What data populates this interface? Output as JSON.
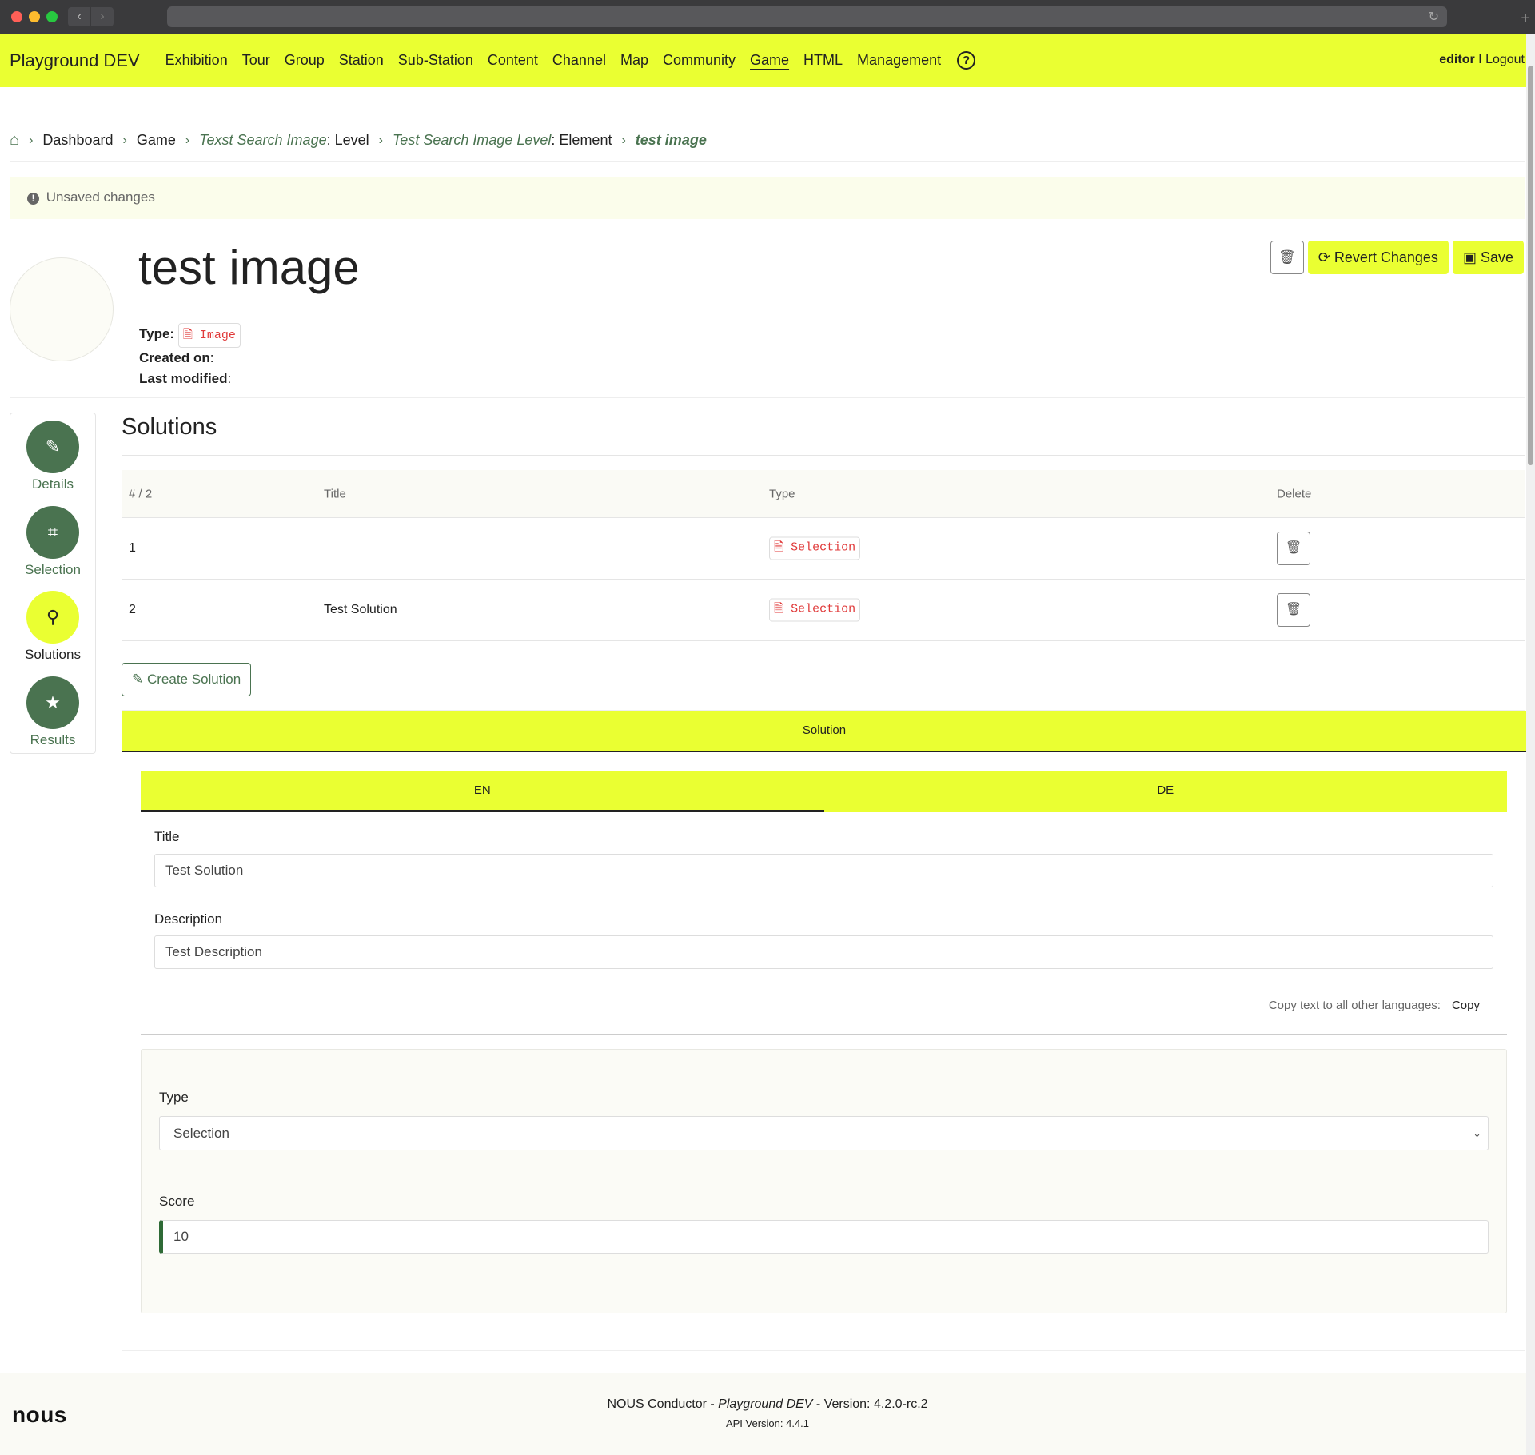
{
  "browser": {
    "reload_icon": "reload-icon",
    "newtab_icon": "plus-icon"
  },
  "nav": {
    "brand": "Playground DEV",
    "items": [
      "Exhibition",
      "Tour",
      "Group",
      "Station",
      "Sub-Station",
      "Content",
      "Channel",
      "Map",
      "Community",
      "Game",
      "HTML",
      "Management"
    ],
    "active": "Game",
    "help": "?",
    "user": "editor",
    "separator": "I",
    "logout": "Logout"
  },
  "breadcrumb": {
    "dashboard": "Dashboard",
    "game": "Game",
    "level_name": "Texst Search Image",
    "level_suffix": ": Level",
    "element_name": "Test Search Image Level",
    "element_suffix": ": Element",
    "current": "test image"
  },
  "status": {
    "unsaved": "Unsaved changes",
    "icon": "!"
  },
  "header": {
    "title": "test image",
    "type_label": "Type:",
    "type_value": "Image",
    "created_label": "Created on",
    "created_value": ":",
    "modified_label": "Last modified",
    "modified_value": ":",
    "revert_label": "Revert Changes",
    "save_label": "Save"
  },
  "sidenav": {
    "items": [
      {
        "label": "Details",
        "icon": "✎"
      },
      {
        "label": "Selection",
        "icon": "⌗"
      },
      {
        "label": "Solutions",
        "icon": "⚲"
      },
      {
        "label": "Results",
        "icon": "★"
      }
    ],
    "active": "Solutions"
  },
  "solutions": {
    "title": "Solutions",
    "columns": [
      "# / 2",
      "Title",
      "Type",
      "Delete"
    ],
    "rows": [
      {
        "num": "1",
        "title": "",
        "type": "Selection"
      },
      {
        "num": "2",
        "title": "Test Solution",
        "type": "Selection"
      }
    ],
    "create_label": "Create Solution"
  },
  "solution_form": {
    "header": "Solution",
    "tabs": [
      "EN",
      "DE"
    ],
    "active_tab": "EN",
    "title_label": "Title",
    "title_value": "Test Solution",
    "description_label": "Description",
    "description_value": "Test Description",
    "copy_text": "Copy text to all other languages:",
    "copy_label": "Copy",
    "type_label": "Type",
    "type_value": "Selection",
    "score_label": "Score",
    "score_value": "10"
  },
  "footer": {
    "logo": "nous",
    "product": "NOUS Conductor",
    "dash1": " - ",
    "instance": "Playground DEV",
    "dash2": " - ",
    "version": "Version: 4.2.0-rc.2",
    "api_version": "API Version: 4.4.1"
  },
  "colors": {
    "accent": "#eaff32",
    "green": "#4a7350",
    "red": "#e03a3a"
  }
}
